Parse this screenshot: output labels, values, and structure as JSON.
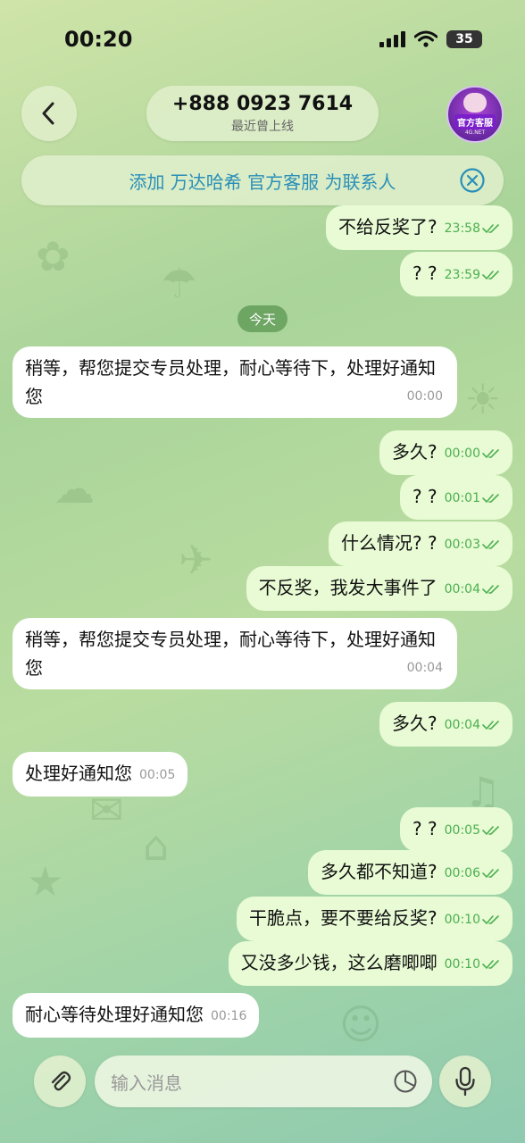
{
  "status_bar": {
    "time": "00:20",
    "battery": "35"
  },
  "header": {
    "title": "+888 0923 7614",
    "subtitle": "最近曾上线",
    "avatar_badge": "官方客服",
    "avatar_small": "4G.NET"
  },
  "add_contact_banner": {
    "text": "添加 万达哈希 官方客服 为联系人"
  },
  "day_separator": "今天",
  "messages": [
    {
      "direction": "out",
      "text": "不给反奖了?",
      "time": "23:58",
      "read": true
    },
    {
      "direction": "out",
      "text": "? ?",
      "time": "23:59",
      "read": true
    },
    {
      "direction": "in",
      "text": "稍等，帮您提交专员处理，耐心等待下，处理好通知您",
      "time": "00:00"
    },
    {
      "direction": "out",
      "text": "多久?",
      "time": "00:00",
      "read": true
    },
    {
      "direction": "out",
      "text": "? ?",
      "time": "00:01",
      "read": true
    },
    {
      "direction": "out",
      "text": "什么情况? ?",
      "time": "00:03",
      "read": true
    },
    {
      "direction": "out",
      "text": "不反奖，我发大事件了",
      "time": "00:04",
      "read": true
    },
    {
      "direction": "in",
      "text": "稍等，帮您提交专员处理，耐心等待下，处理好通知您",
      "time": "00:04"
    },
    {
      "direction": "out",
      "text": "多久?",
      "time": "00:04",
      "read": true
    },
    {
      "direction": "in",
      "text": "处理好通知您",
      "time": "00:05"
    },
    {
      "direction": "out",
      "text": "? ?",
      "time": "00:05",
      "read": true
    },
    {
      "direction": "out",
      "text": "多久都不知道?",
      "time": "00:06",
      "read": true
    },
    {
      "direction": "out",
      "text": "干脆点，要不要给反奖?",
      "time": "00:10",
      "read": true
    },
    {
      "direction": "out",
      "text": "又没多少钱，这么磨唧唧",
      "time": "00:10",
      "read": true
    },
    {
      "direction": "in",
      "text": "耐心等待处理好通知您",
      "time": "00:16"
    }
  ],
  "composer": {
    "placeholder": "输入消息"
  },
  "icons": {
    "back": "chevron-left-icon",
    "close": "close-circle-icon",
    "attach": "paperclip-icon",
    "sticker": "sticker-icon",
    "mic": "microphone-icon",
    "read": "double-check-icon"
  },
  "colors": {
    "outgoing_bubble": "#e8fbd4",
    "incoming_bubble": "#ffffff",
    "read_tick": "#4caf50",
    "link": "#2a8fb8"
  }
}
